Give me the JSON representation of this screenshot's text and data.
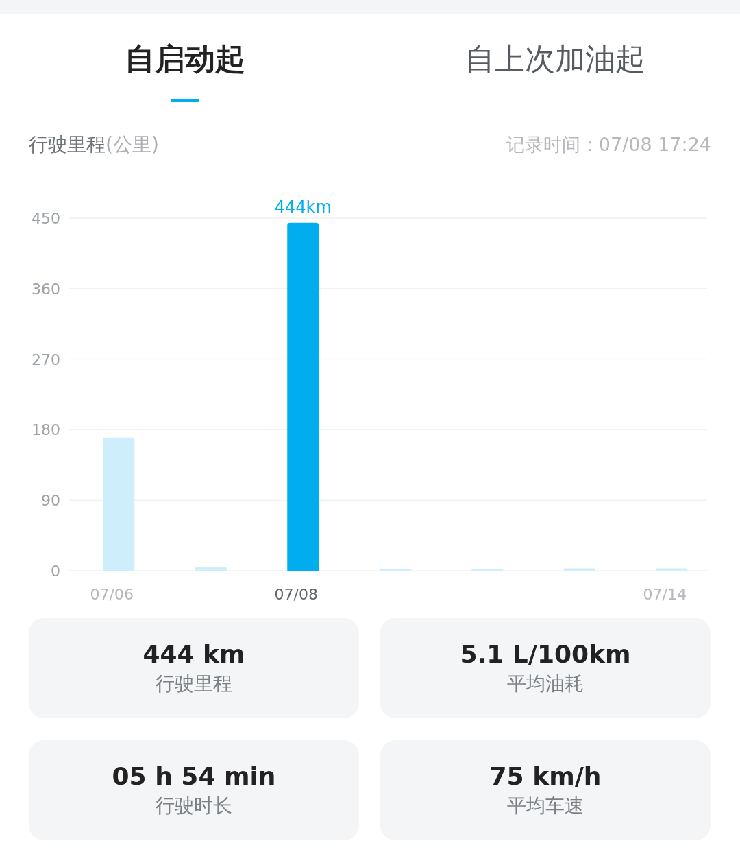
{
  "tabs": [
    {
      "label": "自启动起",
      "selected": true
    },
    {
      "label": "自上次加油起",
      "selected": false
    }
  ],
  "record_time": "记录时间：07/08 17:24",
  "chart": {
    "bars": [
      {
        "selected": false
      },
      {
        "selected": false
      },
      {
        "selected": true
      },
      {
        "selected": false
      },
      {
        "selected": false
      },
      {
        "selected": false
      },
      {
        "selected": false
      }
    ],
    "chart_data": {
      "type": "bar",
      "title": "行驶里程",
      "ylabel": "(公里)",
      "grid": true,
      "categories": [
        "07/06",
        null,
        "07/08",
        null,
        null,
        null,
        "07/14"
      ],
      "values": [
        170,
        5,
        444,
        2,
        2,
        3,
        3
      ],
      "ylim": [
        0,
        450
      ],
      "yticks": [
        0,
        90,
        180,
        270,
        360,
        450
      ],
      "annotations": [
        "444km"
      ]
    }
  },
  "stats": [
    {
      "value": "444 km",
      "label": "行驶里程"
    },
    {
      "value": "5.1 L/100km",
      "label": "平均油耗"
    },
    {
      "value": "05 h 54 min",
      "label": "行驶时长"
    },
    {
      "value": "75 km/h",
      "label": "平均车速"
    }
  ]
}
